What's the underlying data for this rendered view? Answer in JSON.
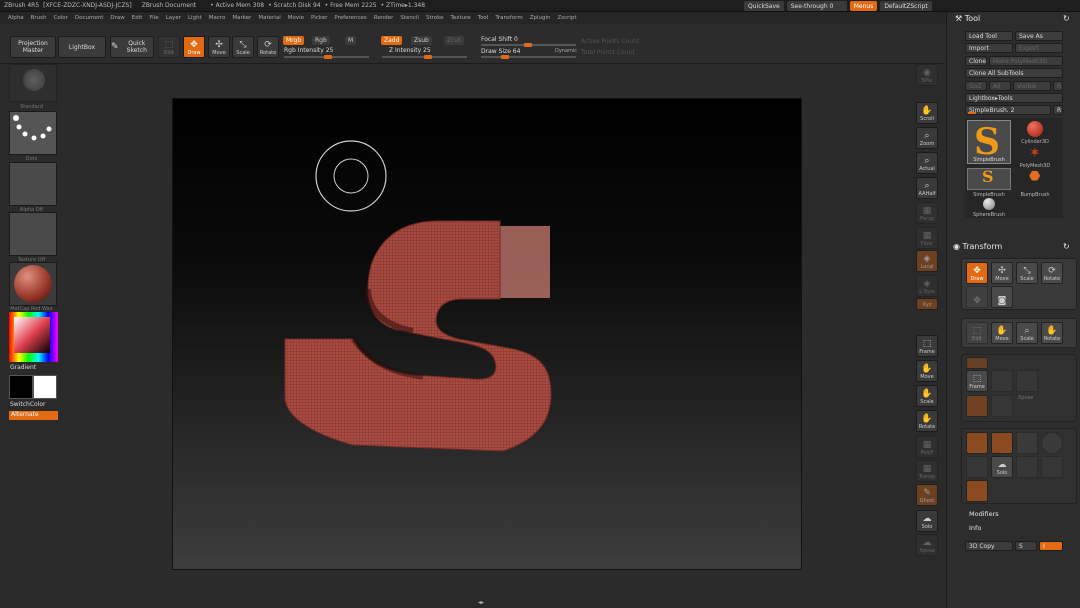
{
  "titlebar": {
    "app": "ZBrush 4R5",
    "session": "[XFCE-ZDZC-XNDJ-ASDJ-JCZS]",
    "document": "ZBrush Document",
    "active_mem": "• Active Mem 308",
    "scratch_disk": "• Scratch Disk 94",
    "free_mem": "• Free Mem 2225",
    "ztime": "• ZTime▸1.348",
    "quicksave": "QuickSave",
    "see_through": "See-through  0",
    "menus": "Menus",
    "default_zscript": "DefaultZScript"
  },
  "menubar": [
    "Alpha",
    "Brush",
    "Color",
    "Document",
    "Draw",
    "Edit",
    "File",
    "Layer",
    "Light",
    "Macro",
    "Marker",
    "Material",
    "Movie",
    "Picker",
    "Preferences",
    "Render",
    "Stencil",
    "Stroke",
    "Texture",
    "Tool",
    "Transform",
    "Zplugin",
    "Zscript"
  ],
  "shelf": {
    "projection_master": "Projection Master",
    "lightbox": "LightBox",
    "quick_sketch": "Quick Sketch",
    "edit": "Edit",
    "draw": "Draw",
    "move": "Move",
    "scale": "Scale",
    "rotate": "Rotate",
    "mrgb": "Mrgb",
    "rgb": "Rgb",
    "m": "M",
    "rgb_intensity": "Rgb Intensity 25",
    "zadd": "Zadd",
    "zsub": "Zsub",
    "zcut": "Zcut",
    "z_intensity": "Z Intensity 25",
    "focal_shift": "Focal Shift 0",
    "draw_size": "Draw Size 64",
    "dynamic": "Dynamic",
    "active_points": "Active Points Count",
    "total_points": "Total Points Count"
  },
  "left": {
    "brush_label": "Standard",
    "stroke_label": "Dots",
    "alpha_label": "Alpha Off",
    "texture_label": "Texture Off",
    "material_label": "MatCap Red Wax",
    "gradient": "Gradient",
    "switch_color": "SwitchColor",
    "alternate": "Alternate"
  },
  "rstrip": {
    "spix": "SPix",
    "scroll": "Scroll",
    "zoom": "Zoom",
    "actual": "Actual",
    "aahalf": "AAHalf",
    "persp": "Persp",
    "floor": "Floor",
    "local": "Local",
    "lsym": "L.Sym",
    "xyz": "Xyz",
    "frame": "Frame",
    "move": "Move",
    "scale": "Scale",
    "rotate": "Rotate",
    "polyf": "PolyF",
    "transp": "Transp",
    "ghost": "Ghost",
    "solo": "Solo",
    "xpose": "Xpose"
  },
  "tool_panel": {
    "title": "Tool",
    "load_tool": "Load Tool",
    "save_as": "Save As",
    "import": "Import",
    "export": "Export",
    "clone": "Clone",
    "make_polymesh": "Make PolyMesh3D",
    "clone_all": "Clone All SubTools",
    "goz": "GoZ",
    "all": "All",
    "visible": "Visible",
    "r": "R",
    "lightbox_tools": "Lightbox▸Tools",
    "current_tool": "SimpleBrush. 2",
    "r2": "R",
    "tools": [
      {
        "name": "Cylinder3D"
      },
      {
        "name": "PolyMesh3D"
      },
      {
        "name": "SimpleBrush"
      },
      {
        "name": "BumpBrush"
      },
      {
        "name": "SphereBrush"
      }
    ],
    "simplebrush_big": "SimpleBrush"
  },
  "transform_panel": {
    "title": "Transform",
    "draw": "Draw",
    "move": "Move",
    "scale": "Scale",
    "rotate": "Rotate",
    "edit": "Edit",
    "move2": "Move",
    "scale2": "Scale",
    "rotate2": "Rotate",
    "frame": "Frame",
    "xpose": "Xpose",
    "solo": "Solo",
    "modifiers": "Modifiers",
    "info": "Info",
    "copy3d": "3D Copy",
    "s": "S",
    "i": "I"
  },
  "colors": {
    "accent": "#e26a13",
    "mesh": "#b04f44",
    "wire": "#6a2520"
  }
}
